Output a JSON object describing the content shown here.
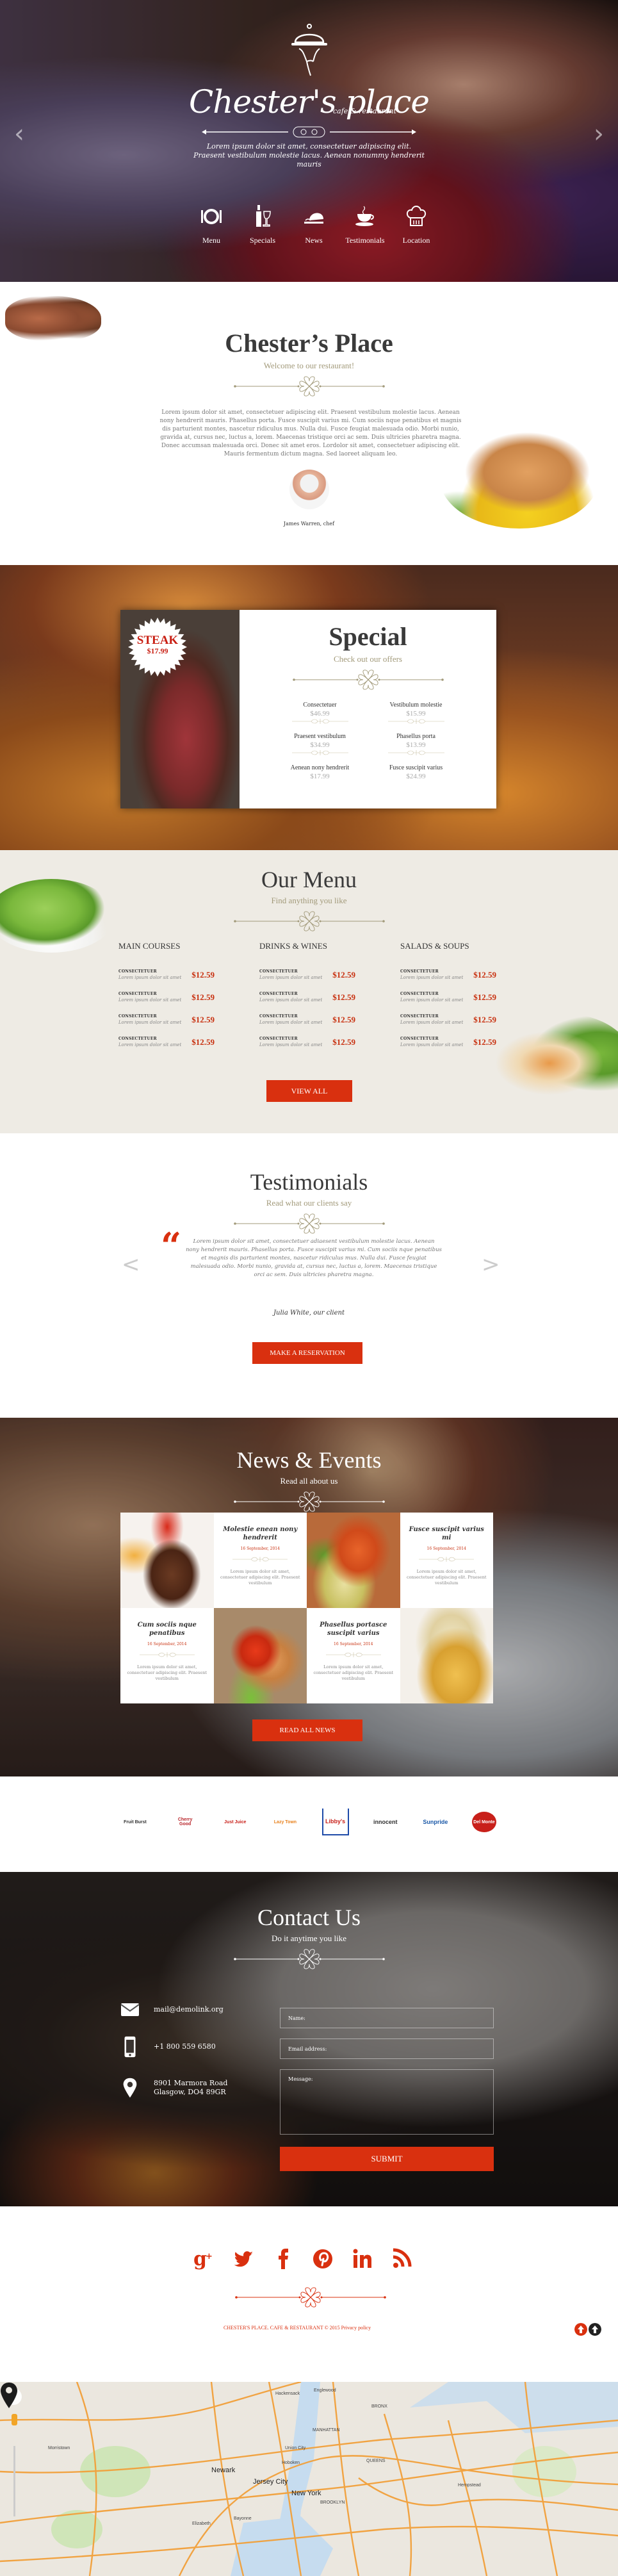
{
  "hero": {
    "brand": "Chester's place",
    "brand_sub": "cafe & restaurant",
    "tagline": "Lorem ipsum dolor sit amet, consectetuer adipiscing elit. Praesent vestibulum molestie lacus. Aenean nonummy hendrerit mauris",
    "prev_arrow": "‹",
    "next_arrow": "›",
    "nav": [
      {
        "label": "Menu",
        "icon": "plate-cutlery-icon"
      },
      {
        "label": "Specials",
        "icon": "wine-bottle-glass-icon"
      },
      {
        "label": "News",
        "icon": "cloche-tray-icon"
      },
      {
        "label": "Testimonials",
        "icon": "coffee-cup-icon"
      },
      {
        "label": "Location",
        "icon": "chef-hat-icon"
      }
    ]
  },
  "welcome": {
    "title": "Chester’s Place",
    "subtitle": "Welcome to our restaurant!",
    "body": "Lorem ipsum dolor sit amet, consectetuer adipiscing elit. Praesent vestibulum molestie lacus. Aenean nony hendrerit mauris. Phasellus porta. Fusce suscipit varius mi. Cum sociis nque penatibus et magnis dis parturient montes, nascetur ridiculus mus. Nulla dui. Fusce feugiat malesuada odio. Morbi nunio, gravida at, cursus nec, luctus a, lorem. Maecenas tristique orci ac sem. Duis ultricies pharetra magna. Donec accumsan malesuada orci. Donec sit amet eros. Lordolor sit amet, consectetuer adipiscing elit. Mauris fermentum dictum magna. Sed laoreet aliquam leo.",
    "chef_name": "James Warren, chef"
  },
  "special": {
    "badge_title": "STEAK",
    "badge_price": "$17.99",
    "title": "Special",
    "subtitle": "Check out our offers",
    "items": [
      {
        "name": "Consectetuer",
        "price": "$46.99"
      },
      {
        "name": "Vestibulum molestie",
        "price": "$15.99"
      },
      {
        "name": "Praesent vestibulum",
        "price": "$34.99"
      },
      {
        "name": "Phasellus porta",
        "price": "$13.99"
      },
      {
        "name": "Aenean nony hendrerit",
        "price": "$17.99"
      },
      {
        "name": "Fusce suscipit varius",
        "price": "$24.99"
      }
    ]
  },
  "menu": {
    "title": "Our Menu",
    "subtitle": "Find anything you like",
    "columns": [
      {
        "heading": "MAIN COURSES",
        "items": [
          {
            "name": "CONSECTETUER",
            "desc": "Lorem ipsum dolor sit amet",
            "price": "$12.59"
          },
          {
            "name": "CONSECTETUER",
            "desc": "Lorem ipsum dolor sit amet",
            "price": "$12.59"
          },
          {
            "name": "CONSECTETUER",
            "desc": "Lorem ipsum dolor sit amet",
            "price": "$12.59"
          },
          {
            "name": "CONSECTETUER",
            "desc": "Lorem ipsum dolor sit amet",
            "price": "$12.59"
          }
        ]
      },
      {
        "heading": "DRINKS & WINES",
        "items": [
          {
            "name": "CONSECTETUER",
            "desc": "Lorem ipsum dolor sit amet",
            "price": "$12.59"
          },
          {
            "name": "CONSECTETUER",
            "desc": "Lorem ipsum dolor sit amet",
            "price": "$12.59"
          },
          {
            "name": "CONSECTETUER",
            "desc": "Lorem ipsum dolor sit amet",
            "price": "$12.59"
          },
          {
            "name": "CONSECTETUER",
            "desc": "Lorem ipsum dolor sit amet",
            "price": "$12.59"
          }
        ]
      },
      {
        "heading": "SALADS & SOUPS",
        "items": [
          {
            "name": "CONSECTETUER",
            "desc": "Lorem ipsum dolor sit amet",
            "price": "$12.59"
          },
          {
            "name": "CONSECTETUER",
            "desc": "Lorem ipsum dolor sit amet",
            "price": "$12.59"
          },
          {
            "name": "CONSECTETUER",
            "desc": "Lorem ipsum dolor sit amet",
            "price": "$12.59"
          },
          {
            "name": "CONSECTETUER",
            "desc": "Lorem ipsum dolor sit amet",
            "price": "$12.59"
          }
        ]
      }
    ],
    "view_all": "VIEW ALL"
  },
  "testimonials": {
    "title": "Testimonials",
    "subtitle": "Read what our clients say",
    "quote_mark": "“",
    "quote": "Lorem ipsum dolor sit amet, consectetuer adiaesent vestibulum molestie lacus. Aenean nony hendrerit mauris. Phasellus porta. Fusce suscipit varius mi. Cum sociis nque penatibus et magnis dis parturient montes, nascetur ridiculus mus. Nulla dui. Fusce feugiat malesuada odio. Morbi nunio, gravida at, cursus nec, luctus a, lorem. Maecenas tristique orci ac sem. Duis ultricies pharetra magna.",
    "author": "Julia White, our client",
    "prev": "<",
    "next": ">",
    "button": "MAKE A RESERVATION"
  },
  "news": {
    "title": "News & Events",
    "subtitle": "Read all about us",
    "posts": [
      {
        "title": "Molestie enean nony hendrerit",
        "date": "16 September, 2014",
        "text": "Lorem ipsum dolor sit amet, consectetuer adipiscing elit. Praesent vestibulum"
      },
      {
        "title": "Fusce suscipit varius mi",
        "date": "16 September, 2014",
        "text": "Lorem ipsum dolor sit amet, consectetuer adipiscing elit. Praesent vestibulum"
      },
      {
        "title": "Cum sociis nque penatibus",
        "date": "16 September, 2014",
        "text": "Lorem ipsum dolor sit amet, consectetuer adipiscing elit. Praesent vestibulum"
      },
      {
        "title": "Phasellus portasce suscipit varius",
        "date": "16 September, 2014",
        "text": "Lorem ipsum dolor sit amet, consectetuer adipiscing elit. Praesent vestibulum"
      }
    ],
    "button": "READ ALL NEWS"
  },
  "brands": [
    {
      "name": "Fruit Burst",
      "color": "#333333"
    },
    {
      "name": "Cherry Good",
      "color": "#b8242a"
    },
    {
      "name": "Just Juice",
      "color": "#c8201a"
    },
    {
      "name": "Lazy Town",
      "color": "#e8821e"
    },
    {
      "name": "Libby's",
      "color": "#c8201a"
    },
    {
      "name": "innocent",
      "color": "#333333"
    },
    {
      "name": "Sunpride",
      "color": "#1d5aa8"
    },
    {
      "name": "Del Monte",
      "color": "#c8201a"
    }
  ],
  "contact": {
    "title": "Contact Us",
    "subtitle": "Do it anytime you like",
    "email": "mail@demolink.org",
    "phone": "+1 800 559 6580",
    "address_line1": "8901 Marmora Road",
    "address_line2": "Glasgow, DO4 89GR",
    "form": {
      "name_placeholder": "Name:",
      "email_placeholder": "Email address:",
      "message_placeholder": "Message:",
      "submit": "SUBMIT"
    }
  },
  "footer": {
    "social": [
      {
        "name": "google-plus",
        "glyph": "g+"
      },
      {
        "name": "twitter",
        "glyph": "t"
      },
      {
        "name": "facebook",
        "glyph": "f"
      },
      {
        "name": "pinterest",
        "glyph": "p"
      },
      {
        "name": "linkedin",
        "glyph": "in"
      },
      {
        "name": "rss",
        "glyph": "rss"
      }
    ],
    "copyright": "CHESTER'S PLACE. CAFE & RESTAURANT © 2015",
    "privacy": "Privacy policy"
  },
  "map": {
    "labels": [
      {
        "text": "New York",
        "big": true
      },
      {
        "text": "Jersey City",
        "big": true
      },
      {
        "text": "Newark",
        "big": true
      },
      {
        "text": "Hoboken",
        "big": false
      },
      {
        "text": "BROOKLYN",
        "big": false
      },
      {
        "text": "QUEENS",
        "big": false
      },
      {
        "text": "MANHATTAN",
        "big": false
      },
      {
        "text": "BRONX",
        "big": false
      },
      {
        "text": "Elizabeth",
        "big": false
      },
      {
        "text": "Bayonne",
        "big": false
      },
      {
        "text": "Hempstead",
        "big": false
      },
      {
        "text": "Morristown",
        "big": false
      },
      {
        "text": "Hackensack",
        "big": false
      },
      {
        "text": "Englewood",
        "big": false
      },
      {
        "text": "Union City",
        "big": false
      }
    ]
  },
  "colors": {
    "accent": "#d9300f",
    "gold": "#a29a7a",
    "menu_bg": "#eeebe4"
  }
}
